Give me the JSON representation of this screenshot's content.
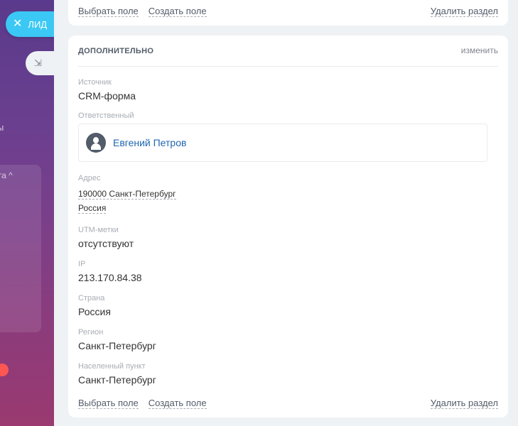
{
  "nav": {
    "lead_tab_label": "ЛИД",
    "close_glyph": "✕",
    "side_button_glyph": "⇲",
    "frag_text_1": "ы",
    "frag_text_2": "га ^"
  },
  "top_card": {
    "select_field": "Выбрать поле",
    "create_field": "Создать поле",
    "delete_section": "Удалить раздел"
  },
  "section": {
    "title": "ДОПОЛНИТЕЛЬНО",
    "edit_label": "изменить",
    "source": {
      "label": "Источник",
      "value": "CRM-форма"
    },
    "responsible": {
      "label": "Ответственный",
      "name": "Евгений Петров"
    },
    "address": {
      "label": "Адрес",
      "line1": "190000 Санкт-Петербург",
      "line2": "Россия"
    },
    "utm": {
      "label": "UTM-метки",
      "value": "отсутствуют"
    },
    "ip": {
      "label": "IP",
      "value": "213.170.84.38"
    },
    "country": {
      "label": "Страна",
      "value": "Россия"
    },
    "region": {
      "label": "Регион",
      "value": "Санкт-Петербург"
    },
    "locality": {
      "label": "Населенный пункт",
      "value": "Санкт-Петербург"
    },
    "select_field": "Выбрать поле",
    "create_field": "Создать поле",
    "delete_section": "Удалить раздел"
  }
}
